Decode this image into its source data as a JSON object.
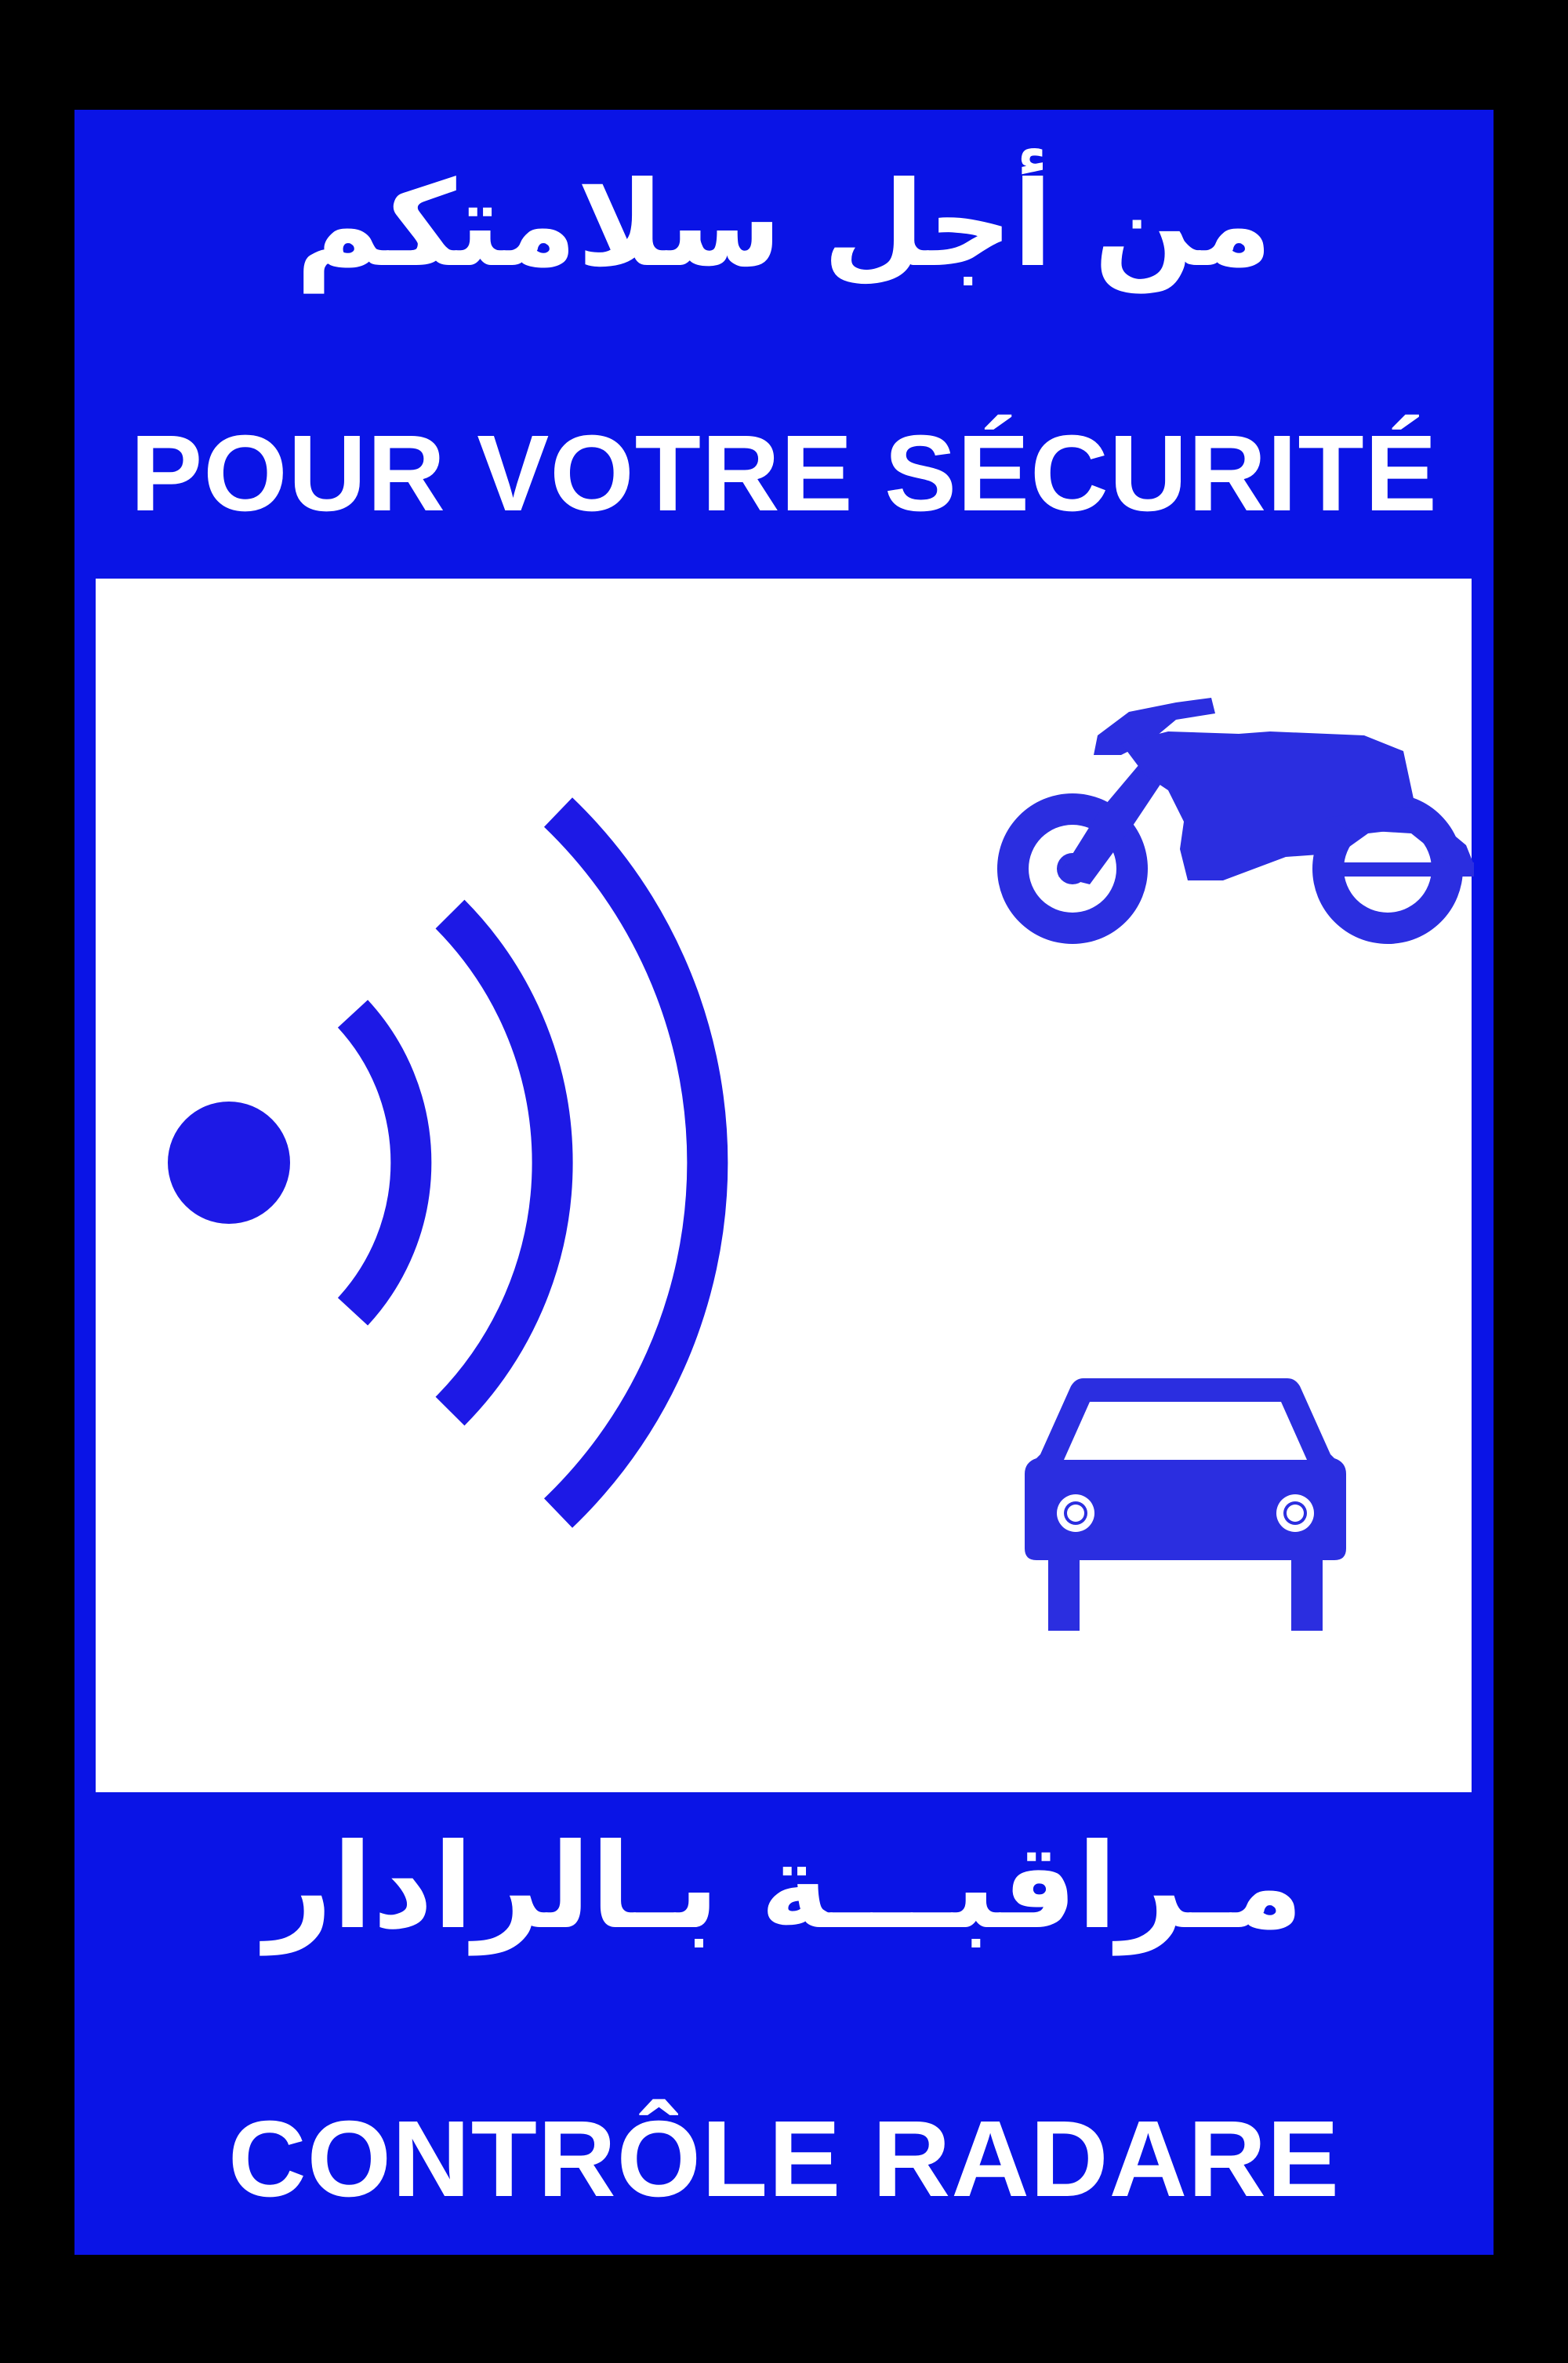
{
  "sign": {
    "arabic_top": "من أجل سلامتكم",
    "french_top": "POUR VOTRE SÉCURITÉ",
    "arabic_bottom": "مـراقبـــة بـالرادار",
    "french_bottom": "CONTRÔLE RADARE"
  },
  "pictograms": [
    "radar-waves-icon",
    "motorcycle-icon",
    "car-icon"
  ],
  "colors": {
    "background": "#000000",
    "sign_blue": "#0a14e6",
    "panel": "#ffffff",
    "symbol_blue": "#2b2ee0",
    "text": "#ffffff"
  }
}
